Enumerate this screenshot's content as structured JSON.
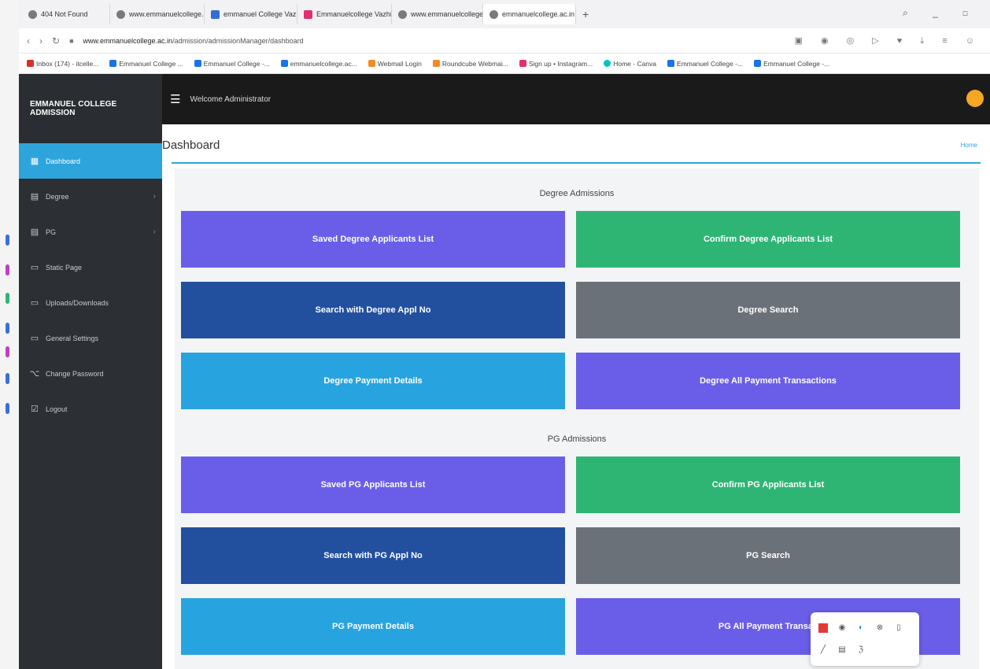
{
  "browser": {
    "tabs": [
      {
        "title": "404 Not Found",
        "color": "#7a7a7a"
      },
      {
        "title": "www.emmanuelcollege.ac",
        "color": "#7a7a7a"
      },
      {
        "title": "emmanuel College Vazhi",
        "color": "#2f6fd6"
      },
      {
        "title": "Emmanuelcollege Vazhi",
        "color": "#e1306c"
      },
      {
        "title": "www.emmanuelcollege.a",
        "color": "#7a7a7a"
      },
      {
        "title": "emmanuelcollege.ac.in A",
        "color": "#7a7a7a"
      }
    ],
    "new_tab": "+",
    "url_host": "www.emmanuelcollege.ac.in",
    "url_path": "/admission/admissionManager/dashboard",
    "bookmarks": [
      {
        "label": "Inbox (174) - itcelle...",
        "color": "#d93025"
      },
      {
        "label": "Emmanuel College ...",
        "color": "#1a73e8"
      },
      {
        "label": "Emmanuel College -...",
        "color": "#1a73e8"
      },
      {
        "label": "emmanuelcollege.ac...",
        "color": "#1a73e8"
      },
      {
        "label": "Webmail Login",
        "color": "#f28b22"
      },
      {
        "label": "Roundcube Webmai...",
        "color": "#f28b22"
      },
      {
        "label": "Sign up • Instagram...",
        "color": "#e1306c"
      },
      {
        "label": "Home - Canva",
        "color": "#00c4cc"
      },
      {
        "label": "Emmanuel College -...",
        "color": "#1a73e8"
      },
      {
        "label": "Emmanuel College -...",
        "color": "#1a73e8"
      }
    ]
  },
  "sidebar": {
    "brand": "EMMANUEL COLLEGE ADMISSION",
    "items": [
      {
        "label": "Dashboard",
        "icon": "dashboard-icon"
      },
      {
        "label": "Degree",
        "icon": "list-icon"
      },
      {
        "label": "PG",
        "icon": "list-icon"
      },
      {
        "label": "Static Page",
        "icon": "page-icon"
      },
      {
        "label": "Uploads/Downloads",
        "icon": "upload-icon"
      },
      {
        "label": "General Settings",
        "icon": "settings-icon"
      },
      {
        "label": "Change Password",
        "icon": "key-icon"
      },
      {
        "label": "Logout",
        "icon": "logout-icon"
      }
    ],
    "active_color": "#2ea4dc"
  },
  "topbar": {
    "welcome": "Welcome Administrator"
  },
  "main": {
    "title": "Dashboard",
    "breadcrumb": "Home",
    "degree": {
      "heading": "Degree Admissions",
      "tiles": [
        "Saved Degree Applicants List",
        "Confirm Degree Applicants List",
        "Search with Degree Appl No",
        "Degree Search",
        "Degree Payment Details",
        "Degree All Payment Transactions"
      ]
    },
    "pg": {
      "heading": "PG Admissions",
      "tiles": [
        "Saved PG Applicants List",
        "Confirm PG Applicants List",
        "Search with PG Appl No",
        "PG Search",
        "PG Payment Details",
        "PG All Payment Transac"
      ]
    }
  },
  "colors": {
    "purple": "#6a5ee8",
    "green": "#2eb574",
    "navy": "#22509f",
    "gray": "#6b7178",
    "sky": "#27a4df"
  }
}
